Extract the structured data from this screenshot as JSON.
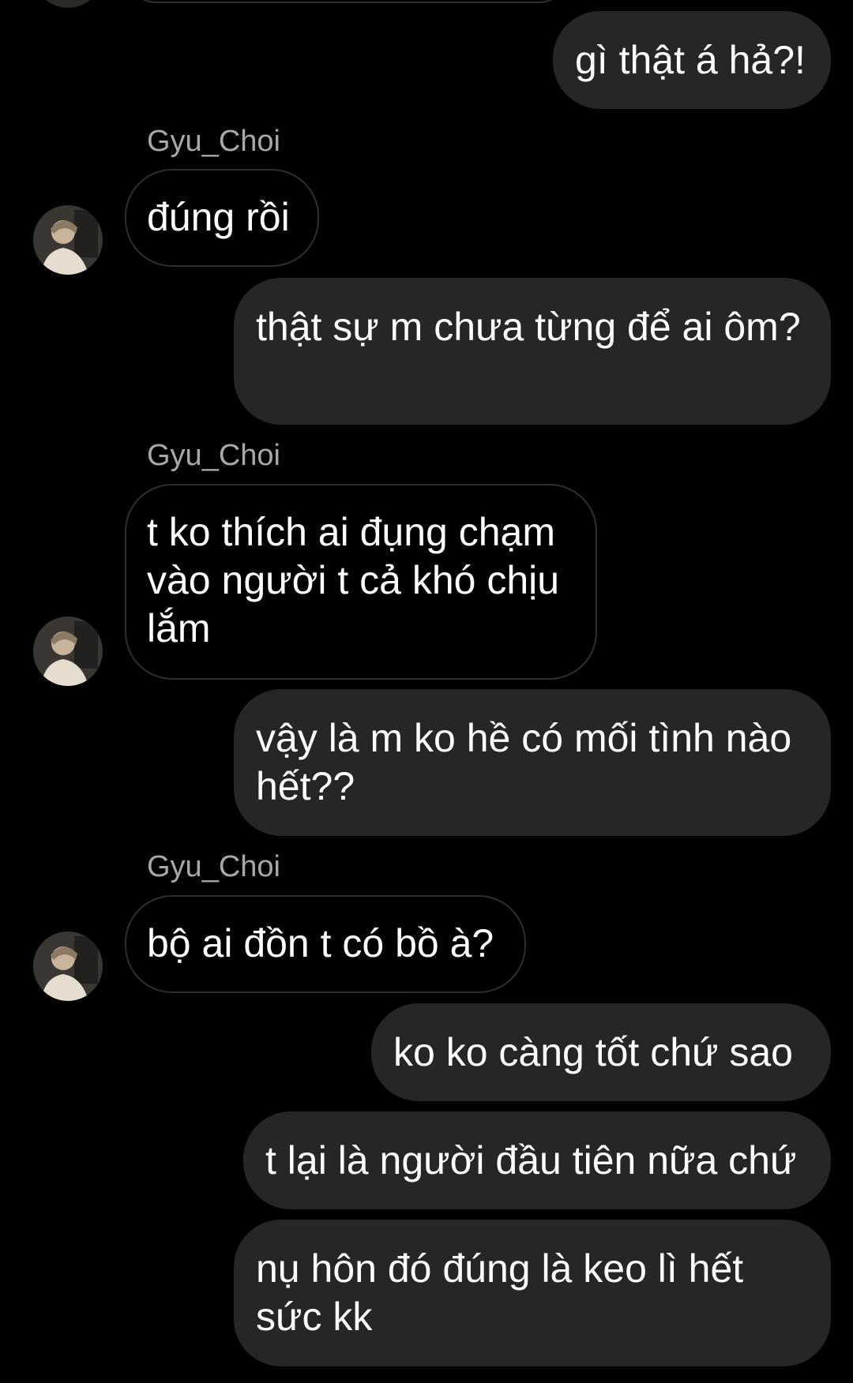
{
  "colors": {
    "background": "#000000",
    "sent_bubble": "#262626",
    "received_border": "#2f2f2f",
    "username_text": "#a8a8a8",
    "message_text": "#ffffff"
  },
  "messages": [
    {
      "from": "me",
      "text": "gì thật á hả?!"
    },
    {
      "from": "Gyu_Choi",
      "sender_label": "Gyu_Choi",
      "text": "đúng rồi",
      "avatar": "profile-photo-avatar"
    },
    {
      "from": "me",
      "text": "thật sự m chưa từng để ai ôm?"
    },
    {
      "from": "Gyu_Choi",
      "sender_label": "Gyu_Choi",
      "text": "t ko thích ai đụng chạm vào người t cả khó chịu lắm",
      "avatar": "profile-photo-avatar"
    },
    {
      "from": "me",
      "text": "vậy là m ko hề có mối tình nào hết??"
    },
    {
      "from": "Gyu_Choi",
      "sender_label": "Gyu_Choi",
      "text": "bộ ai đồn t có bồ à?",
      "avatar": "profile-photo-avatar"
    },
    {
      "from": "me",
      "text": "ko ko càng tốt chứ sao"
    },
    {
      "from": "me",
      "text": "t lại là người đầu tiên nữa chứ"
    },
    {
      "from": "me",
      "text": "nụ hôn đó đúng là keo lì hết sức kk"
    }
  ]
}
